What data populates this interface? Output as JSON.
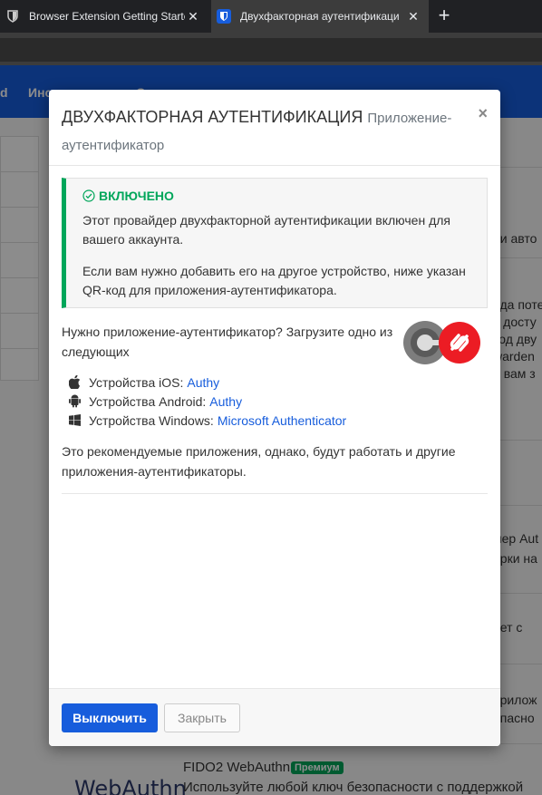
{
  "browser": {
    "tabs": [
      {
        "label": "Browser Extension Getting Starte",
        "close": "✕"
      },
      {
        "label": "Двухфакторная аутентификаци",
        "close": "✕"
      }
    ],
    "new_tab": "+"
  },
  "background": {
    "nav": {
      "item1": "d",
      "item2": "Инс",
      "item3": "С"
    },
    "fragments": [
      "ои авто",
      "ода поте",
      "ь досту",
      "тод дву",
      "warden",
      "и вам з",
      "мер Aut",
      "ерки на",
      "ает с",
      "прилож",
      "опасно"
    ],
    "webauthn_logo": "WebAuthn",
    "fido_title": "FIDO2 WebAuthn",
    "premium_badge": "Премиум",
    "fido_desc": "Используйте любой ключ безопасности с поддержкой"
  },
  "modal": {
    "title": "ДВУХФАКТОРНАЯ АУТЕНТИФИКАЦИЯ",
    "subtitle": "Приложение-аутентификатор",
    "close": "×",
    "alert": {
      "heading": "ВКЛЮЧЕНО",
      "text1": "Этот провайдер двухфакторной аутентификации включен для вашего аккаунта.",
      "text2": "Если вам нужно добавить его на другое устройство, ниже указан QR-код для приложения-аутентификатора."
    },
    "need_app": "Нужно приложение-аутентификатор? Загрузите одно из следующих",
    "devices": [
      {
        "label": "Устройства iOS:",
        "app": "Authy",
        "icon": "apple-icon"
      },
      {
        "label": "Устройства Android:",
        "app": "Authy",
        "icon": "android-icon"
      },
      {
        "label": "Устройства Windows:",
        "app": "Microsoft Authenticator",
        "icon": "windows-icon"
      }
    ],
    "recommend": "Это рекомендуемые приложения, однако, будут работать и другие приложения-аутентификаторы.",
    "disable_button": "Выключить",
    "close_button": "Закрыть"
  },
  "colors": {
    "primary": "#175ddc",
    "success": "#00a65a",
    "authy": "#ec1c24"
  }
}
